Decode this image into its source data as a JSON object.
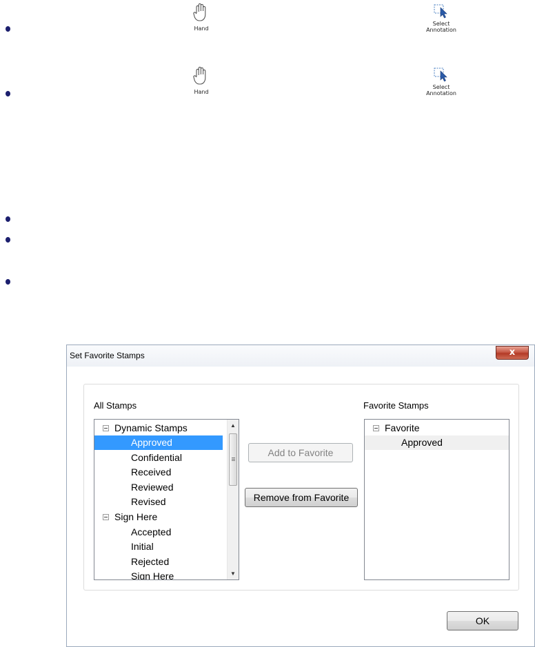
{
  "toolbar_rows": [
    {
      "hand_label": "Hand",
      "select_label_line1": "Select",
      "select_label_line2": "Annotation"
    },
    {
      "hand_label": "Hand",
      "select_label_line1": "Select",
      "select_label_line2": "Annotation"
    }
  ],
  "dialog": {
    "title": "Set Favorite Stamps",
    "close_label": "x",
    "all_stamps_header": "All Stamps",
    "favorite_stamps_header": "Favorite Stamps",
    "all_stamps": [
      {
        "label": "Dynamic Stamps",
        "group": true
      },
      {
        "label": "Approved",
        "selected": true
      },
      {
        "label": "Confidential"
      },
      {
        "label": "Received"
      },
      {
        "label": "Reviewed"
      },
      {
        "label": "Revised"
      },
      {
        "label": "Sign Here",
        "group": true
      },
      {
        "label": "Accepted"
      },
      {
        "label": "Initial"
      },
      {
        "label": "Rejected"
      },
      {
        "label": "Sign Here"
      }
    ],
    "favorite_stamps": [
      {
        "label": "Favorite",
        "group": true
      },
      {
        "label": "Approved",
        "highlighted": true
      }
    ],
    "add_button": "Add to Favorite",
    "remove_button": "Remove from Favorite",
    "ok_button": "OK"
  },
  "colors": {
    "selection": "#3399ff",
    "bullet": "#1c1f6e",
    "close_button": "#c75a47"
  },
  "icons": [
    "hand-icon",
    "select-annotation-icon",
    "collapse-icon",
    "scroll-up-icon",
    "scroll-down-icon"
  ]
}
